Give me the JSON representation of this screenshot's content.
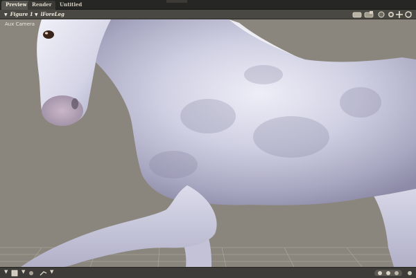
{
  "tabs": [
    {
      "label": "Preview",
      "active": true
    },
    {
      "label": "Render",
      "active": false
    },
    {
      "label": "Untitled",
      "active": false
    }
  ],
  "toolbar": {
    "figure_menu": "Figure 1",
    "part_menu": "lForeLeg",
    "icons": [
      "screenshot-icon",
      "window-icon",
      "shading-icon",
      "orbit-icon",
      "move-icon",
      "rotate-icon"
    ]
  },
  "viewport": {
    "camera_label": "Aux Camera",
    "background_color": "#8a867d",
    "floor_grid": true
  },
  "bottom_bar": {
    "icons": [
      "menu-arrow-icon",
      "square-icon",
      "lock-icon",
      "key-icon",
      "options-arrow-icon",
      "dot-icon"
    ]
  },
  "colors": {
    "frame": "#3e3c38",
    "tab_active": "#575550",
    "horse_light": "#e4e4f1",
    "horse_shadow": "#8e8ca6"
  }
}
